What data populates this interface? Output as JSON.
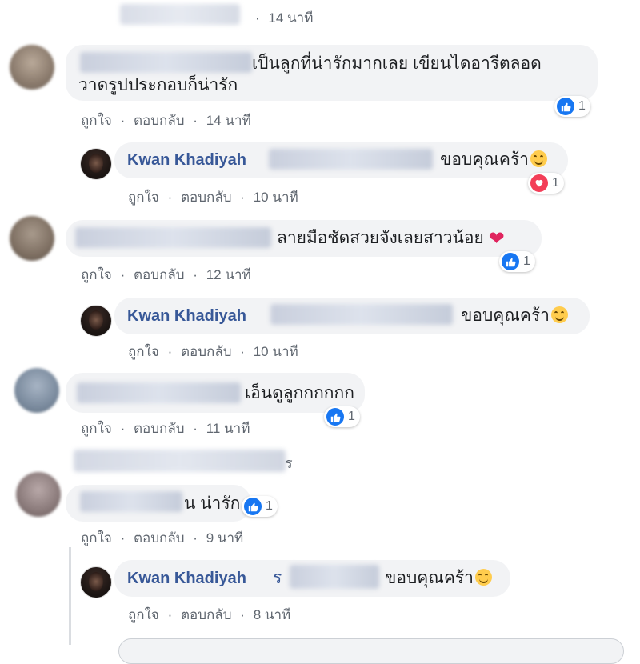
{
  "actions": {
    "like": "ถูกใจ",
    "reply": "ตอบกลับ",
    "sep": "·"
  },
  "comments": [
    {
      "time": "14 นาที"
    },
    {
      "text_line1": "เป็นลูกที่น่ารักมากเลย เขียนไดอารีตลอด",
      "text_line2": "วาดรูปประกอบก็น่ารัก",
      "reaction_count": "1",
      "time": "14 นาที"
    },
    {
      "name": "Kwan Khadiyah",
      "text": "ขอบคุณคร้า",
      "reaction_count": "1",
      "time": "10 นาที"
    },
    {
      "text": "ลายมือชัดสวยจังเลยสาวน้อย",
      "reaction_count": "1",
      "time": "12 นาที"
    },
    {
      "name": "Kwan Khadiyah",
      "text": "ขอบคุณคร้า",
      "time": "10 นาที"
    },
    {
      "text": "เอ็นดูลูกกกกกก",
      "reaction_count": "1",
      "time": "11 นาที"
    },
    {
      "partial": "ร"
    },
    {
      "text": "น่ารัก",
      "text_prefix": "น",
      "reaction_count": "1",
      "time": "9 นาที"
    },
    {
      "name": "Kwan Khadiyah",
      "text": "ขอบคุณคร้า",
      "text_prefix": "ร",
      "time": "8 นาที"
    }
  ],
  "colors": {
    "name": "#385898",
    "bubble": "#f2f3f5",
    "like": "#1877f2",
    "love": "#f33e58",
    "meta": "#606770"
  }
}
